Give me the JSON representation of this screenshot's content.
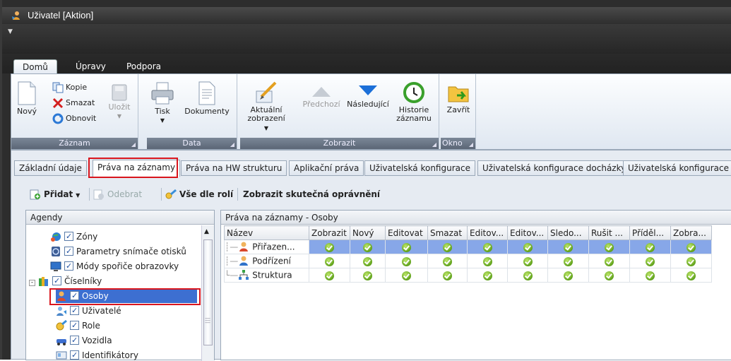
{
  "window": {
    "title": "Uživatel [Aktion]"
  },
  "ribbon_tabs": [
    "Domů",
    "Úpravy",
    "Podpora"
  ],
  "ribbon": {
    "groups": {
      "zaznam": {
        "label": "Záznam",
        "novy": "Nový",
        "kopie": "Kopie",
        "smazat": "Smazat",
        "obnovit": "Obnovit",
        "ulozit": "Uložit"
      },
      "data": {
        "label": "Data",
        "tisk": "Tisk",
        "dokumenty": "Dokumenty"
      },
      "zobrazit": {
        "label": "Zobrazit",
        "aktualni1": "Aktuální",
        "aktualni2": "zobrazení",
        "predchozi": "Předchozí",
        "nasledujici": "Následující",
        "historie1": "Historie",
        "historie2": "záznamu"
      },
      "okno": {
        "label": "Okno",
        "zavrit": "Zavřít"
      }
    }
  },
  "page_tabs": [
    "Základní údaje",
    "Práva na záznamy",
    "Práva na HW strukturu",
    "Aplikační práva",
    "Uživatelská konfigurace",
    "Uživatelská konfigurace docházky",
    "Uživatelská konfigurace"
  ],
  "toolbar": {
    "pridat": "Přidat",
    "odebrat": "Odebrat",
    "vse_dle_roli": "Vše dle rolí",
    "zobrazit_opravneni": "Zobrazit skutečná oprávnění"
  },
  "agendy": {
    "header": "Agendy",
    "items": [
      "Zóny",
      "Parametry snímače otisků",
      "Módy spořiče obrazovky",
      "Číselníky",
      "Osoby",
      "Uživatelé",
      "Role",
      "Vozidla",
      "Identifikátory"
    ]
  },
  "grid": {
    "header": "Práva na záznamy - Osoby",
    "columns": [
      "Název",
      "Zobrazit",
      "Nový",
      "Editovat",
      "Smazat",
      "Editov...",
      "Editov...",
      "Sledo...",
      "Rušit ...",
      "Příděl...",
      "Zobra..."
    ],
    "rows": [
      "Přiřazen...",
      "Podřízení",
      "Struktura"
    ]
  },
  "colors": {
    "accent": "#3d6fd1",
    "highlight": "#d9151d",
    "check": "#5fa11a"
  }
}
